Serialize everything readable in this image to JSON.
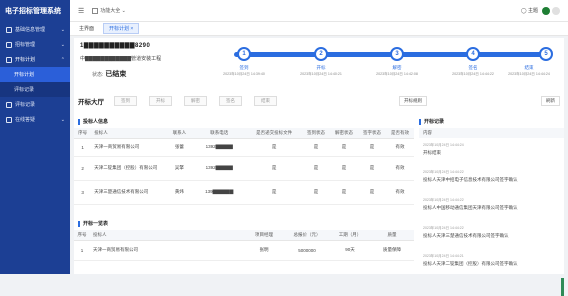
{
  "brand": "电子招标管理系统",
  "sidebar": {
    "items": [
      {
        "label": "基础信息管理"
      },
      {
        "label": "招标管理"
      },
      {
        "label": "开标计划"
      },
      {
        "label": "评标记录"
      },
      {
        "label": "在线答疑"
      }
    ],
    "submenu": [
      {
        "label": "开标计划"
      },
      {
        "label": "评标记录"
      }
    ]
  },
  "topbar": {
    "breadcrumb": "功能大全",
    "theme_label": "主题",
    "user_initial": "B"
  },
  "tabs": [
    {
      "label": "主界面"
    },
    {
      "label": "开标计划 ×"
    }
  ],
  "project": {
    "code": "1▇▇▇▇▇▇▇▇▇▇8290",
    "name": "中▇▇▇▇▇▇▇▇▇▇▇▇管道安装工程",
    "status_label": "状态:",
    "status_value": "已结束"
  },
  "steps": [
    {
      "num": "1",
      "name": "签到",
      "time": "2023年10月24日 14:39:40"
    },
    {
      "num": "2",
      "name": "开标",
      "time": "2023年10月24日 14:40:21"
    },
    {
      "num": "3",
      "name": "解密",
      "time": "2023年10月24日 14:42:08"
    },
    {
      "num": "4",
      "name": "签名",
      "time": "2023年10月24日 14:44:22"
    },
    {
      "num": "5",
      "name": "结束",
      "time": "2023年10月24日 14:44:24"
    }
  ],
  "hall": {
    "title": "开标大厅",
    "buttons": [
      "签到",
      "开标",
      "解密",
      "签名",
      "结束"
    ],
    "right_buttons": [
      "开标规则",
      "刷新"
    ]
  },
  "bidders": {
    "section_title": "投标人信息",
    "headers": [
      "序号",
      "投标人",
      "联系人",
      "联系电话",
      "是否递交投标文件",
      "签到状态",
      "解密状态",
      "签字状态",
      "是否有效"
    ],
    "rows": [
      {
        "no": "1",
        "name": "天津一商贸易有限公司",
        "contact": "张蕾",
        "phone": "1392▇▇▇▇▇",
        "submitted": "是",
        "signin": "是",
        "decrypt": "是",
        "sign": "是",
        "valid": "有效"
      },
      {
        "no": "2",
        "name": "天津二锭集团（控股）有限公司",
        "contact": "吴擎",
        "phone": "1392▇▇▇▇▇",
        "submitted": "是",
        "signin": "是",
        "decrypt": "是",
        "sign": "是",
        "valid": "有效"
      },
      {
        "no": "3",
        "name": "天津三楚通信技术有限公司",
        "contact": "黄炜",
        "phone": "139▇▇▇▇▇▇",
        "submitted": "是",
        "signin": "是",
        "decrypt": "是",
        "sign": "是",
        "valid": "有效"
      }
    ]
  },
  "quotes": {
    "section_title": "开标一览表",
    "headers": [
      "序号",
      "投标人",
      "项目经理",
      "总报价（元）",
      "工期（月）",
      "质量"
    ],
    "rows": [
      {
        "no": "1",
        "name": "天津一商贸易有限公司",
        "manager": "张明",
        "price": "5000000",
        "period": "90天",
        "quality": "质量保障"
      }
    ]
  },
  "records": {
    "section_title": "开标记录",
    "header": "内容",
    "items": [
      {
        "time": "2023年10月24日 14:44:24",
        "content": "开标结束"
      },
      {
        "time": "2023年10月24日 14:44:22",
        "content": "投标人天津中招电子信息技术有限公司签字确认"
      },
      {
        "time": "2023年10月24日 14:44:22",
        "content": "投标人中国移动通信集团天津有限公司签字确认"
      },
      {
        "time": "2023年10月24日 14:44:22",
        "content": "投标人天津三楚通信技术有限公司签字确认"
      },
      {
        "time": "2023年10月24日 14:44:21",
        "content": "投标人天津二锭集团（控股）有限公司签字确认"
      }
    ]
  }
}
